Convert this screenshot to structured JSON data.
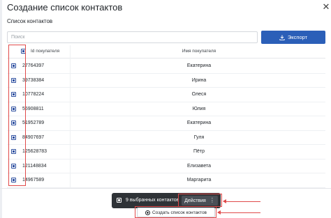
{
  "dialog": {
    "title": "Создание список контактов"
  },
  "section": {
    "title": "Список контактов"
  },
  "search": {
    "placeholder": "Поиск",
    "value": ""
  },
  "toolbar": {
    "export_label": "Экспорт"
  },
  "table": {
    "columns": [
      "Id покупателя",
      "Имя покупателя"
    ],
    "rows": [
      {
        "id": "27764397",
        "name": "Екатерина",
        "selected": true
      },
      {
        "id": "39738384",
        "name": "Ирина",
        "selected": true
      },
      {
        "id": "10778224",
        "name": "Олеся",
        "selected": true
      },
      {
        "id": "55908811",
        "name": "Юлия",
        "selected": true
      },
      {
        "id": "51952789",
        "name": "Екатерина",
        "selected": true
      },
      {
        "id": "84907697",
        "name": "Гуля",
        "selected": true
      },
      {
        "id": "125628783",
        "name": "Пётр",
        "selected": true
      },
      {
        "id": "121148834",
        "name": "Елизавета",
        "selected": true
      },
      {
        "id": "14967589",
        "name": "Маргарита",
        "selected": true
      }
    ]
  },
  "action_bar": {
    "selected_text": "9 выбранных контактов",
    "actions_label": "Действия"
  },
  "footer": {
    "create_label": "Создать список контактов"
  },
  "colors": {
    "accent": "#2b5fb8",
    "annotation": "#e04a4a",
    "action_bar_bg": "#2f3337"
  }
}
